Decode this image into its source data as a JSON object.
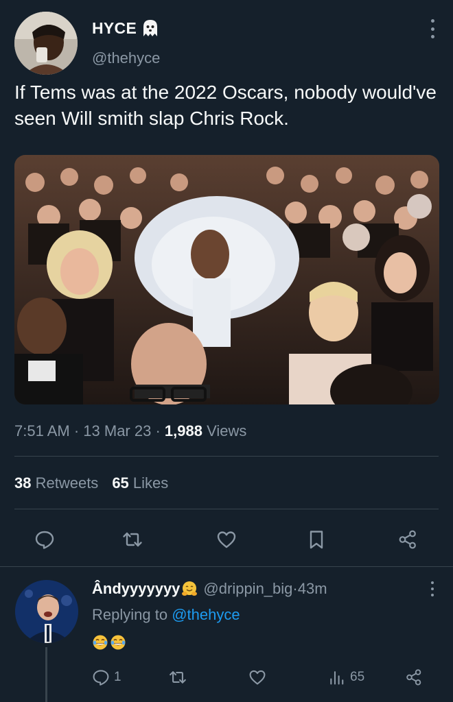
{
  "tweet": {
    "author_name": "HYCE",
    "author_handle": "@thehyce",
    "text": "If Tems was at the 2022 Oscars, nobody would've seen Will smith slap Chris Rock.",
    "time": "7:51 AM",
    "sep1": " · ",
    "date": "13 Mar 23",
    "sep2": " · ",
    "views_count": "1,988",
    "views_label": " Views",
    "retweets_count": "38",
    "retweets_label": " Retweets",
    "likes_count": "65",
    "likes_label": " Likes"
  },
  "actions": [
    "reply-icon",
    "retweet-icon",
    "like-icon",
    "bookmark-icon",
    "share-icon"
  ],
  "reply": {
    "author_name": "Ândyyyyyyy",
    "author_handle": "@drippin_big",
    "sep": " · ",
    "time_ago": "43m",
    "replying_prefix": "Replying to ",
    "replying_mention": "@thehyce",
    "emojis": [
      "face-with-tears-of-joy",
      "face-with-tears-of-joy"
    ],
    "reply_count": "1",
    "views_count": "65"
  },
  "colors": {
    "background": "#15202b",
    "text_primary": "#f7f9f9",
    "text_secondary": "#8b98a5",
    "accent": "#1d9bf0",
    "divider": "#38444d"
  }
}
